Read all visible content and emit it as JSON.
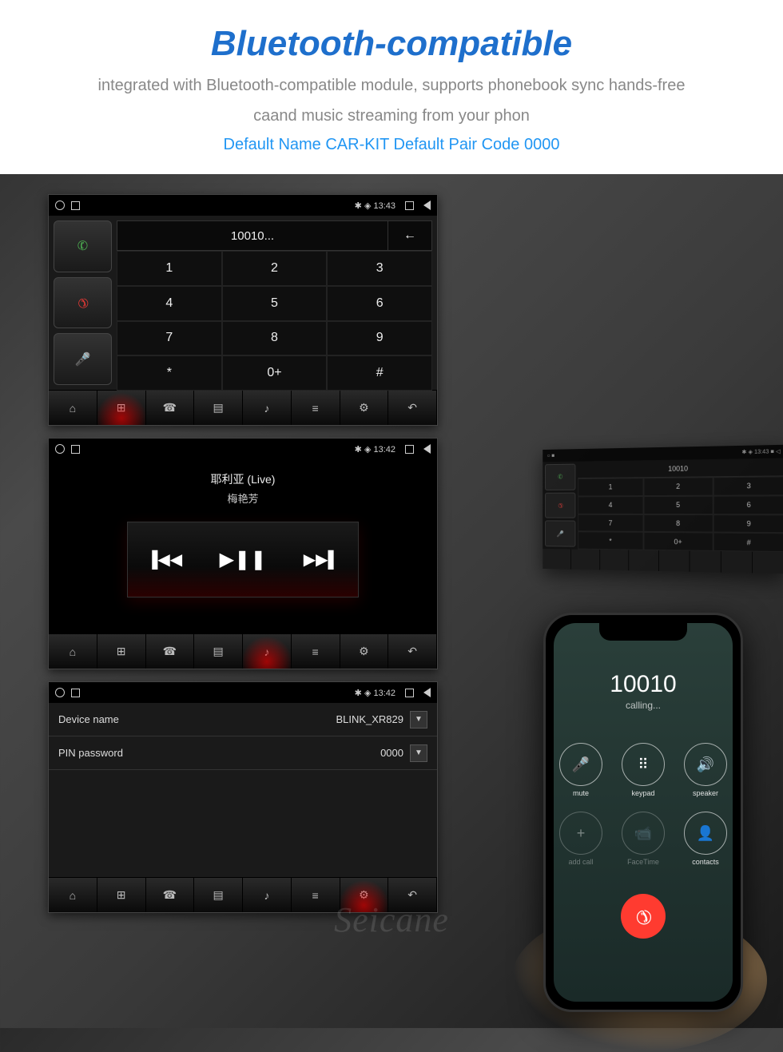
{
  "header": {
    "title": "Bluetooth-compatible",
    "subtitle_line1": "integrated with Bluetooth-compatible module, supports phonebook sync hands-free",
    "subtitle_line2": "caand music streaming from your phon",
    "default_info": "Default Name CAR-KIT Default Pair Code 0000"
  },
  "screen1": {
    "status_time": "13:43",
    "dialed_number": "10010...",
    "keys": [
      "1",
      "2",
      "3",
      "4",
      "5",
      "6",
      "7",
      "8",
      "9",
      "*",
      "0+",
      "#"
    ]
  },
  "screen2": {
    "status_time": "13:42",
    "track_title": "耶利亚 (Live)",
    "track_artist": "梅艳芳"
  },
  "screen3": {
    "status_time": "13:42",
    "device_name_label": "Device name",
    "device_name_value": "BLINK_XR829",
    "pin_label": "PIN password",
    "pin_value": "0000"
  },
  "mini": {
    "status_time": "13:43",
    "dialed_number": "10010",
    "keys": [
      "1",
      "2",
      "3",
      "4",
      "5",
      "6",
      "7",
      "8",
      "9",
      "*",
      "0+",
      "#"
    ]
  },
  "phone": {
    "calling_number": "10010",
    "calling_status": "calling...",
    "actions": [
      {
        "label": "mute",
        "icon": "🎤"
      },
      {
        "label": "keypad",
        "icon": "⠿"
      },
      {
        "label": "speaker",
        "icon": "🔊"
      },
      {
        "label": "add call",
        "icon": "+",
        "dim": true
      },
      {
        "label": "FaceTime",
        "icon": "📹",
        "dim": true
      },
      {
        "label": "contacts",
        "icon": "👤"
      }
    ]
  },
  "watermark": "Seicane"
}
